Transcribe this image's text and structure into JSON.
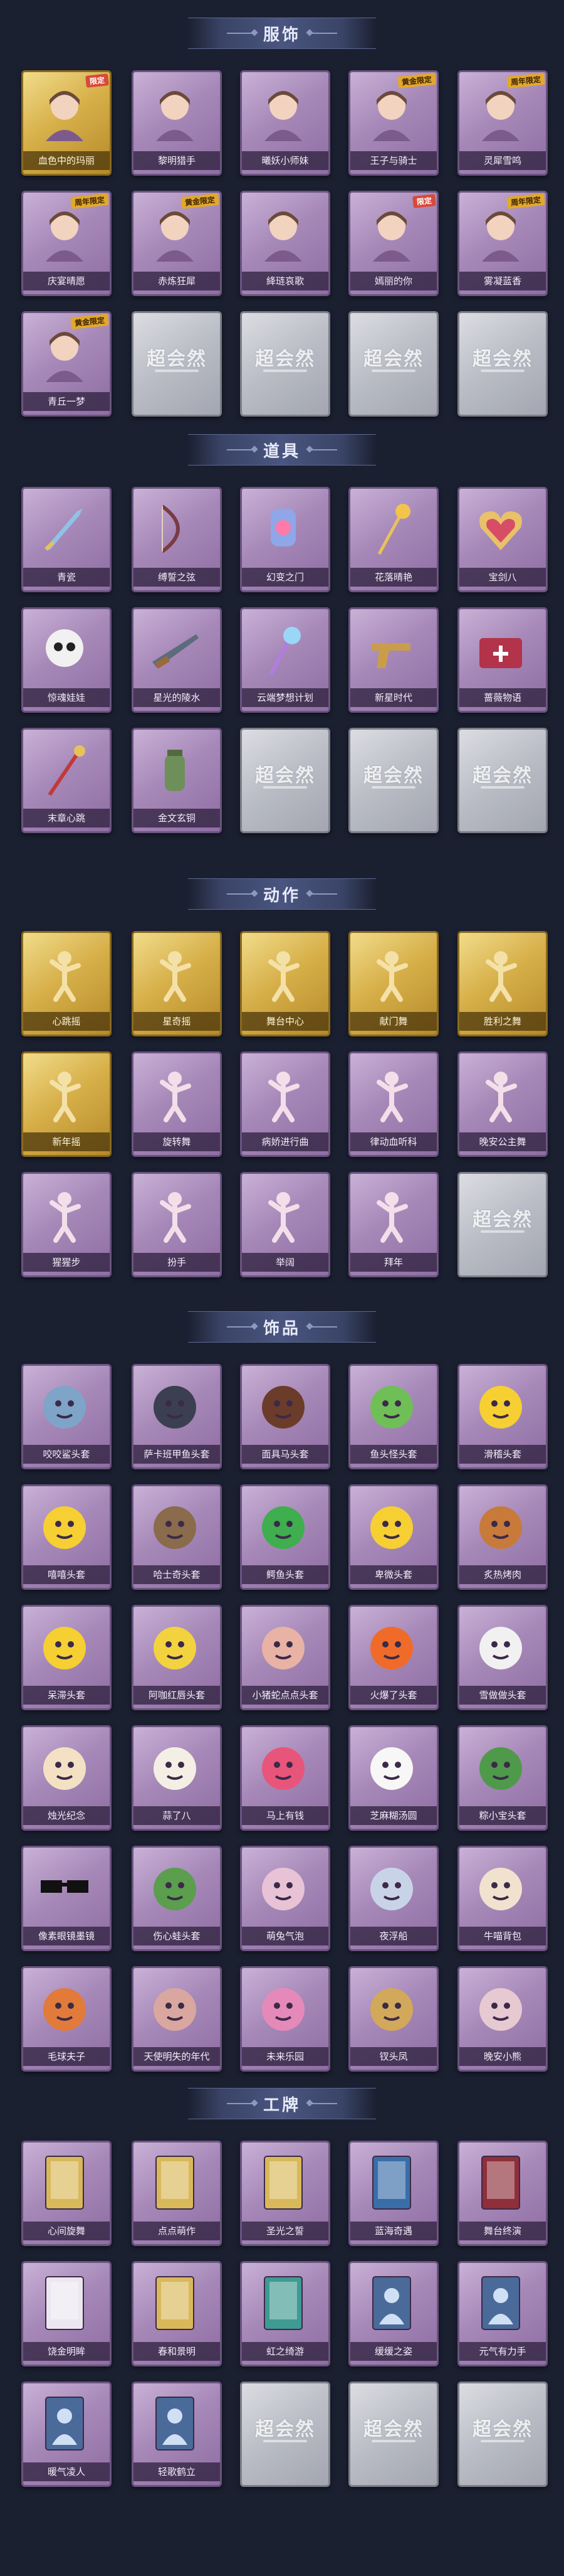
{
  "placeholder_text": "超会然",
  "sections": [
    {
      "title": "服饰",
      "items": [
        {
          "label": "血色中的玛丽",
          "tier": "gold",
          "icon": "portrait-icon",
          "badge": "限定"
        },
        {
          "label": "黎明猎手",
          "tier": "purple",
          "icon": "portrait-icon"
        },
        {
          "label": "曦妖小师妹",
          "tier": "purple",
          "icon": "portrait-icon"
        },
        {
          "label": "王子与骑士",
          "tier": "purple",
          "icon": "portrait-icon",
          "badge": "黄金限定"
        },
        {
          "label": "灵犀雪鸣",
          "tier": "purple",
          "icon": "portrait-icon",
          "badge": "周年限定"
        },
        {
          "label": "庆宴晴愿",
          "tier": "purple",
          "icon": "portrait-icon",
          "badge": "周年限定"
        },
        {
          "label": "赤炼狂犀",
          "tier": "purple",
          "icon": "portrait-icon",
          "badge": "黄金限定"
        },
        {
          "label": "絳琏哀歌",
          "tier": "purple",
          "icon": "portrait-icon"
        },
        {
          "label": "嫣丽的你",
          "tier": "purple",
          "icon": "portrait-icon",
          "badge": "限定"
        },
        {
          "label": "雾凝蓝香",
          "tier": "purple",
          "icon": "portrait-icon",
          "badge": "周年限定"
        },
        {
          "label": "青丘一梦",
          "tier": "purple",
          "icon": "portrait-icon",
          "badge": "黄金限定"
        },
        {
          "label": "",
          "tier": "gray",
          "icon": "placeholder"
        },
        {
          "label": "",
          "tier": "gray",
          "icon": "placeholder"
        },
        {
          "label": "",
          "tier": "gray",
          "icon": "placeholder"
        },
        {
          "label": "",
          "tier": "gray",
          "icon": "placeholder"
        }
      ]
    },
    {
      "title": "道具",
      "items": [
        {
          "label": "青瓷",
          "tier": "purple",
          "icon": "sword-icon"
        },
        {
          "label": "缚誓之弦",
          "tier": "purple",
          "icon": "bow-icon"
        },
        {
          "label": "幻变之门",
          "tier": "purple",
          "icon": "gem-icon"
        },
        {
          "label": "花落晴艳",
          "tier": "purple",
          "icon": "flower-staff-icon"
        },
        {
          "label": "宝剑八",
          "tier": "purple",
          "icon": "heart-mirror-icon"
        },
        {
          "label": "惊魂娃娃",
          "tier": "purple",
          "icon": "skull-icon"
        },
        {
          "label": "星光的陵水",
          "tier": "purple",
          "icon": "rifle-icon"
        },
        {
          "label": "云端梦想计划",
          "tier": "purple",
          "icon": "wand-icon"
        },
        {
          "label": "新星时代",
          "tier": "purple",
          "icon": "pistol-icon"
        },
        {
          "label": "蔷薇物语",
          "tier": "purple",
          "icon": "chest-icon"
        },
        {
          "label": "末章心跳",
          "tier": "purple",
          "icon": "scepter-icon"
        },
        {
          "label": "金文玄铜",
          "tier": "purple",
          "icon": "jar-icon"
        },
        {
          "label": "",
          "tier": "gray",
          "icon": "placeholder"
        },
        {
          "label": "",
          "tier": "gray",
          "icon": "placeholder"
        },
        {
          "label": "",
          "tier": "gray",
          "icon": "placeholder"
        }
      ]
    },
    {
      "title": "动作",
      "items": [
        {
          "label": "心跳摇",
          "tier": "gold",
          "icon": "pose-icon"
        },
        {
          "label": "星奇摇",
          "tier": "gold",
          "icon": "pose-icon"
        },
        {
          "label": "舞台中心",
          "tier": "gold",
          "icon": "pose-icon"
        },
        {
          "label": "献门舞",
          "tier": "gold",
          "icon": "pose-icon"
        },
        {
          "label": "胜利之舞",
          "tier": "gold",
          "icon": "pose-icon"
        },
        {
          "label": "新年摇",
          "tier": "gold",
          "icon": "pose-icon"
        },
        {
          "label": "旋转舞",
          "tier": "purple",
          "icon": "pose-icon"
        },
        {
          "label": "病娇进行曲",
          "tier": "purple",
          "icon": "pose-icon"
        },
        {
          "label": "律动血听科",
          "tier": "purple",
          "icon": "pose-icon"
        },
        {
          "label": "晚安公主舞",
          "tier": "purple",
          "icon": "pose-icon"
        },
        {
          "label": "猩猩步",
          "tier": "purple",
          "icon": "pose-icon"
        },
        {
          "label": "扮手",
          "tier": "purple",
          "icon": "pose-icon"
        },
        {
          "label": "举阔",
          "tier": "purple",
          "icon": "pose-icon"
        },
        {
          "label": "拜年",
          "tier": "purple",
          "icon": "pose-icon"
        },
        {
          "label": "",
          "tier": "gray",
          "icon": "placeholder"
        }
      ]
    },
    {
      "title": "饰品",
      "items": [
        {
          "label": "咬咬鲨头套",
          "tier": "purple",
          "icon": "shark-icon"
        },
        {
          "label": "萨卡班甲鱼头套",
          "tier": "purple",
          "icon": "fish-icon"
        },
        {
          "label": "面具马头套",
          "tier": "purple",
          "icon": "horse-icon"
        },
        {
          "label": "鱼头怪头套",
          "tier": "purple",
          "icon": "fish-head-icon"
        },
        {
          "label": "滑稽头套",
          "tier": "purple",
          "icon": "smile-icon"
        },
        {
          "label": "嘻嘻头套",
          "tier": "purple",
          "icon": "grin-icon"
        },
        {
          "label": "哈士奇头套",
          "tier": "purple",
          "icon": "dog-icon"
        },
        {
          "label": "鳄鱼头套",
          "tier": "purple",
          "icon": "croc-icon"
        },
        {
          "label": "卑微头套",
          "tier": "purple",
          "icon": "sad-icon"
        },
        {
          "label": "炙热烤肉",
          "tier": "purple",
          "icon": "meat-icon"
        },
        {
          "label": "呆滞头套",
          "tier": "purple",
          "icon": "dazed-icon"
        },
        {
          "label": "阿咖红唇头套",
          "tier": "purple",
          "icon": "duck-icon"
        },
        {
          "label": "小猪蛇点点头套",
          "tier": "purple",
          "icon": "slime-icon"
        },
        {
          "label": "火爆了头套",
          "tier": "purple",
          "icon": "fire-icon"
        },
        {
          "label": "雪做做头套",
          "tier": "purple",
          "icon": "snowman-icon"
        },
        {
          "label": "烛光纪念",
          "tier": "purple",
          "icon": "candle-icon"
        },
        {
          "label": "蒜了八",
          "tier": "purple",
          "icon": "garlic-icon"
        },
        {
          "label": "马上有钱",
          "tier": "purple",
          "icon": "pony-icon"
        },
        {
          "label": "芝麻糊汤圆",
          "tier": "purple",
          "icon": "dumpling-icon"
        },
        {
          "label": "粽小宝头套",
          "tier": "purple",
          "icon": "zongzi-icon"
        },
        {
          "label": "像素眼镜墨镜",
          "tier": "purple",
          "icon": "sunglasses-icon"
        },
        {
          "label": "伤心蛙头套",
          "tier": "purple",
          "icon": "frog-icon"
        },
        {
          "label": "萌兔气泡",
          "tier": "purple",
          "icon": "bubble-icon"
        },
        {
          "label": "夜浮船",
          "tier": "purple",
          "icon": "spirit-icon"
        },
        {
          "label": "牛喵背包",
          "tier": "purple",
          "icon": "backpack-icon"
        },
        {
          "label": "毛球夫子",
          "tier": "purple",
          "icon": "cat-doll-icon"
        },
        {
          "label": "天使明失的年代",
          "tier": "purple",
          "icon": "doll-icon"
        },
        {
          "label": "未来乐园",
          "tier": "purple",
          "icon": "fairy-icon"
        },
        {
          "label": "钗头凤",
          "tier": "purple",
          "icon": "crown-icon"
        },
        {
          "label": "晚安小熊",
          "tier": "purple",
          "icon": "bear-icon"
        }
      ]
    },
    {
      "title": "工牌",
      "items": [
        {
          "label": "心间旋舞",
          "tier": "purple",
          "icon": "card-gold-icon"
        },
        {
          "label": "点点萌作",
          "tier": "purple",
          "icon": "card-gold-icon"
        },
        {
          "label": "圣光之誓",
          "tier": "purple",
          "icon": "card-gold-icon"
        },
        {
          "label": "蓝海奇遇",
          "tier": "purple",
          "icon": "card-blue-icon"
        },
        {
          "label": "舞台终演",
          "tier": "purple",
          "icon": "card-red-icon"
        },
        {
          "label": "饶金明眸",
          "tier": "purple",
          "icon": "card-white-icon"
        },
        {
          "label": "春和景明",
          "tier": "purple",
          "icon": "card-gold-icon"
        },
        {
          "label": "虹之绮游",
          "tier": "purple",
          "icon": "card-teal-icon"
        },
        {
          "label": "缓缓之姿",
          "tier": "purple",
          "icon": "card-silhouette-icon"
        },
        {
          "label": "元气有力手",
          "tier": "purple",
          "icon": "card-silhouette-icon"
        },
        {
          "label": "暖气凌人",
          "tier": "purple",
          "icon": "card-silhouette-icon"
        },
        {
          "label": "轻歌鹤立",
          "tier": "purple",
          "icon": "card-silhouette-icon"
        },
        {
          "label": "",
          "tier": "gray",
          "icon": "placeholder"
        },
        {
          "label": "",
          "tier": "gray",
          "icon": "placeholder"
        },
        {
          "label": "",
          "tier": "gray",
          "icon": "placeholder"
        }
      ]
    }
  ]
}
